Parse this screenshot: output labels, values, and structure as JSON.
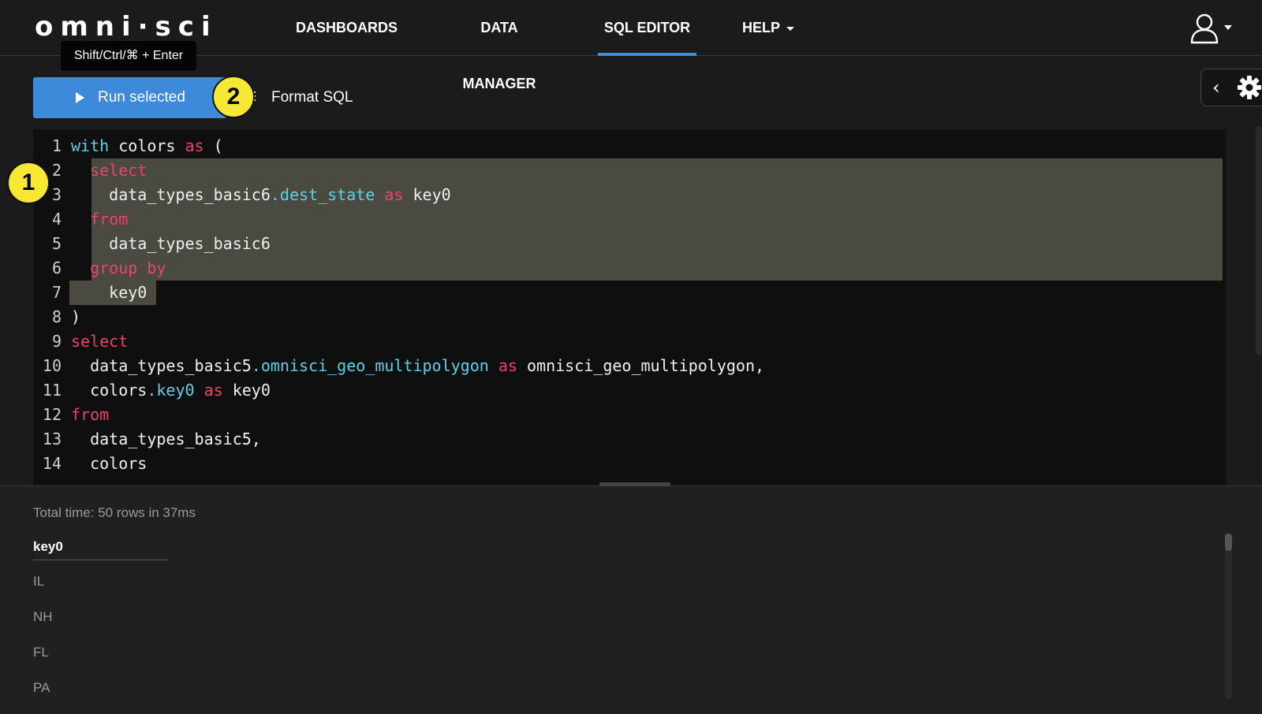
{
  "app": {
    "logo": "omni·sci"
  },
  "nav": {
    "items": [
      {
        "label": "DASHBOARDS"
      },
      {
        "label": "DATA MANAGER"
      },
      {
        "label": "SQL EDITOR",
        "active": true
      },
      {
        "label": "HELP"
      }
    ],
    "user_icon": "user-icon"
  },
  "tooltip": {
    "text": "Shift/Ctrl/⌘ + Enter"
  },
  "toolbar": {
    "run_label": "Run selected",
    "format_label": "Format SQL",
    "run_color": "#3c8ad9"
  },
  "callouts": [
    "1",
    "2"
  ],
  "editor": {
    "lines": [
      {
        "n": "1",
        "tokens": [
          [
            "kw2",
            "with"
          ],
          [
            "plain",
            " colors "
          ],
          [
            "kw",
            "as"
          ],
          [
            "plain",
            " ("
          ]
        ]
      },
      {
        "n": "2",
        "tokens": [
          [
            "plain",
            "  "
          ],
          [
            "kw",
            "select"
          ]
        ]
      },
      {
        "n": "3",
        "tokens": [
          [
            "plain",
            "    data_types_basic6"
          ],
          [
            "fld",
            ".dest_state"
          ],
          [
            "plain",
            " "
          ],
          [
            "kw",
            "as"
          ],
          [
            "plain",
            " key0"
          ]
        ]
      },
      {
        "n": "4",
        "tokens": [
          [
            "plain",
            "  "
          ],
          [
            "kw",
            "from"
          ]
        ]
      },
      {
        "n": "5",
        "tokens": [
          [
            "plain",
            "    data_types_basic6"
          ]
        ]
      },
      {
        "n": "6",
        "tokens": [
          [
            "plain",
            "  "
          ],
          [
            "kw",
            "group by"
          ]
        ]
      },
      {
        "n": "7",
        "tokens": [
          [
            "plain",
            "    key0"
          ]
        ]
      },
      {
        "n": "8",
        "tokens": [
          [
            "plain",
            ")"
          ]
        ]
      },
      {
        "n": "9",
        "tokens": [
          [
            "kw",
            "select"
          ]
        ]
      },
      {
        "n": "10",
        "tokens": [
          [
            "plain",
            "  data_types_basic5"
          ],
          [
            "fld",
            ".omnisci_geo_multipolygon"
          ],
          [
            "plain",
            " "
          ],
          [
            "kw",
            "as"
          ],
          [
            "plain",
            " omnisci_geo_multipolygon,"
          ]
        ]
      },
      {
        "n": "11",
        "tokens": [
          [
            "plain",
            "  colors"
          ],
          [
            "fld",
            ".key0"
          ],
          [
            "plain",
            " "
          ],
          [
            "kw",
            "as"
          ],
          [
            "plain",
            " key0"
          ]
        ]
      },
      {
        "n": "12",
        "tokens": [
          [
            "kw",
            "from"
          ]
        ]
      },
      {
        "n": "13",
        "tokens": [
          [
            "plain",
            "  data_types_basic5,"
          ]
        ]
      },
      {
        "n": "14",
        "tokens": [
          [
            "plain",
            "  colors"
          ]
        ]
      }
    ],
    "colors": {
      "keyword": "#e8456d",
      "field": "#5fcfe8",
      "selection": "#4a4a41"
    }
  },
  "results": {
    "summary": "Total time: 50 rows in 37ms",
    "column": "key0",
    "rows": [
      "IL",
      "NH",
      "FL",
      "PA"
    ]
  }
}
